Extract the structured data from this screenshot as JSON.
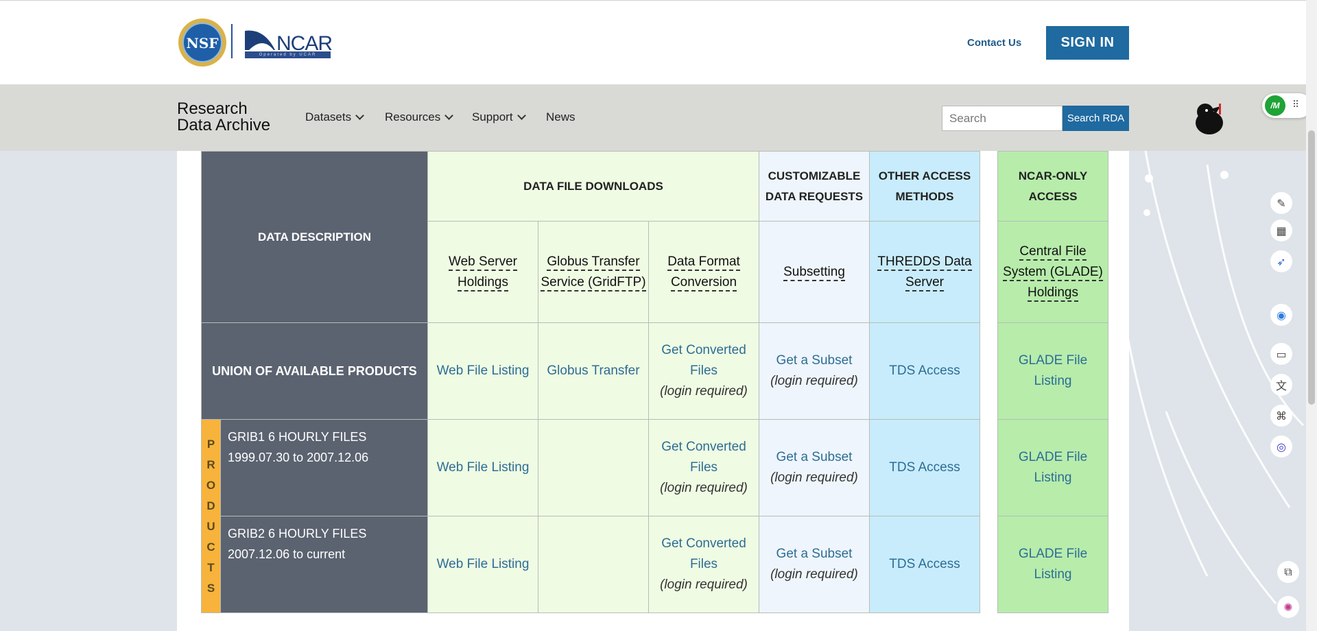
{
  "header": {
    "logo_left": "NSF",
    "logo_right": "NCAR",
    "logo_right_sub": "Operated by UCAR",
    "contact_label": "Contact Us",
    "signin_label": "SIGN IN"
  },
  "nav": {
    "brand_line1": "Research",
    "brand_line2": "Data Archive",
    "items": [
      {
        "label": "Datasets"
      },
      {
        "label": "Resources"
      },
      {
        "label": "Support"
      },
      {
        "label": "News"
      }
    ],
    "search_placeholder": "Search",
    "search_button": "Search RDA"
  },
  "table": {
    "desc_header": "DATA DESCRIPTION",
    "groups": {
      "downloads": "DATA FILE DOWNLOADS",
      "custom": "CUSTOMIZABLE DATA REQUESTS",
      "other": "OTHER ACCESS METHODS",
      "ncar": "NCAR-ONLY ACCESS"
    },
    "subheaders": {
      "web": "Web Server Holdings",
      "globus": "Globus Transfer Service (GridFTP)",
      "format": "Data Format Conversion",
      "subset": "Subsetting",
      "thredds": "THREDDS Data Server",
      "glade": "Central File System (GLADE) Holdings"
    },
    "products_label": [
      "P",
      "R",
      "O",
      "D",
      "U",
      "C",
      "T",
      "S"
    ],
    "union_label": "UNION OF AVAILABLE PRODUCTS",
    "links": {
      "web_file": "Web File Listing",
      "globus": "Globus Transfer",
      "converted": "Get Converted Files",
      "subset": "Get a Subset",
      "login": "(login required)",
      "tds": "TDS Access",
      "glade": "GLADE File Listing"
    },
    "rows": [
      {
        "name": "GRIB1 6 HOURLY FILES 1999.07.30 to 2007.12.06"
      },
      {
        "name": "GRIB2 6 HOURLY FILES 2007.12.06 to current"
      }
    ]
  },
  "colors": {
    "brand_blue": "#1f6aa0",
    "dark_cell": "#5b6370",
    "downloads_bg": "#effbe3",
    "custom_bg": "#eef5fc",
    "other_bg": "#c8ecfb",
    "ncar_bg": "#b7ecab",
    "products_bg": "#f7b33b"
  },
  "side_badge": "/M"
}
